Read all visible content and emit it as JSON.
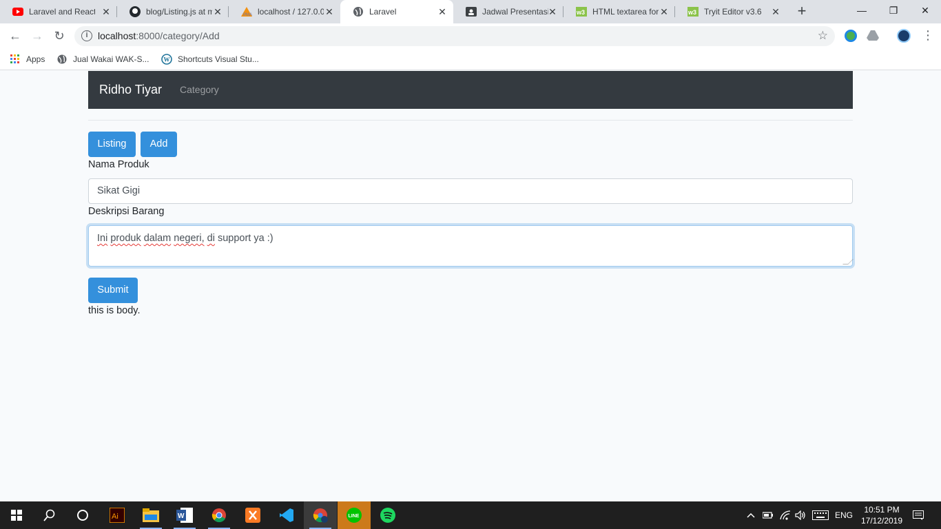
{
  "tabs": [
    {
      "title": "Laravel and React.js",
      "icon": "youtube-icon"
    },
    {
      "title": "blog/Listing.js at m",
      "icon": "github-icon"
    },
    {
      "title": "localhost / 127.0.0",
      "icon": "phpmyadmin-icon"
    },
    {
      "title": "Laravel",
      "icon": "globe-icon",
      "active": true
    },
    {
      "title": "Jadwal Presentasi T",
      "icon": "contact-icon"
    },
    {
      "title": "HTML textarea for",
      "icon": "w3schools-icon"
    },
    {
      "title": "Tryit Editor v3.6",
      "icon": "w3schools-icon"
    }
  ],
  "address": {
    "host": "localhost",
    "path": ":8000/category/Add"
  },
  "bookmarks": [
    {
      "label": "Apps",
      "icon": "apps-grid-icon"
    },
    {
      "label": "Jual Wakai WAK-S...",
      "icon": "globe-icon"
    },
    {
      "label": "Shortcuts Visual Stu...",
      "icon": "wordpress-icon"
    }
  ],
  "navbar": {
    "brand": "Ridho Tiyar",
    "link": "Category"
  },
  "buttons": {
    "listing": "Listing",
    "add": "Add",
    "submit": "Submit"
  },
  "form": {
    "name_label": "Nama Produk",
    "name_value": "Sikat Gigi",
    "desc_label": "Deskripsi Barang",
    "desc_word1": "Ini",
    "desc_word2": "produk",
    "desc_word3": "dalam",
    "desc_word4": "negeri,",
    "desc_word5": "di",
    "desc_rest": " support ya :)"
  },
  "body_text": "this is body.",
  "taskbar": {
    "apps": [
      "windows-start-icon",
      "search-icon",
      "cortana-icon",
      "illustrator-icon",
      "file-explorer-icon",
      "word-icon",
      "chrome-icon",
      "xampp-icon",
      "vscode-icon",
      "chrome-profile-icon",
      "line-icon",
      "spotify-icon"
    ],
    "lang": "ENG",
    "time": "10:51 PM",
    "date": "17/12/2019"
  },
  "colors": {
    "primary": "#3490dc",
    "navbar": "#343a40",
    "background": "#f8fafc"
  }
}
